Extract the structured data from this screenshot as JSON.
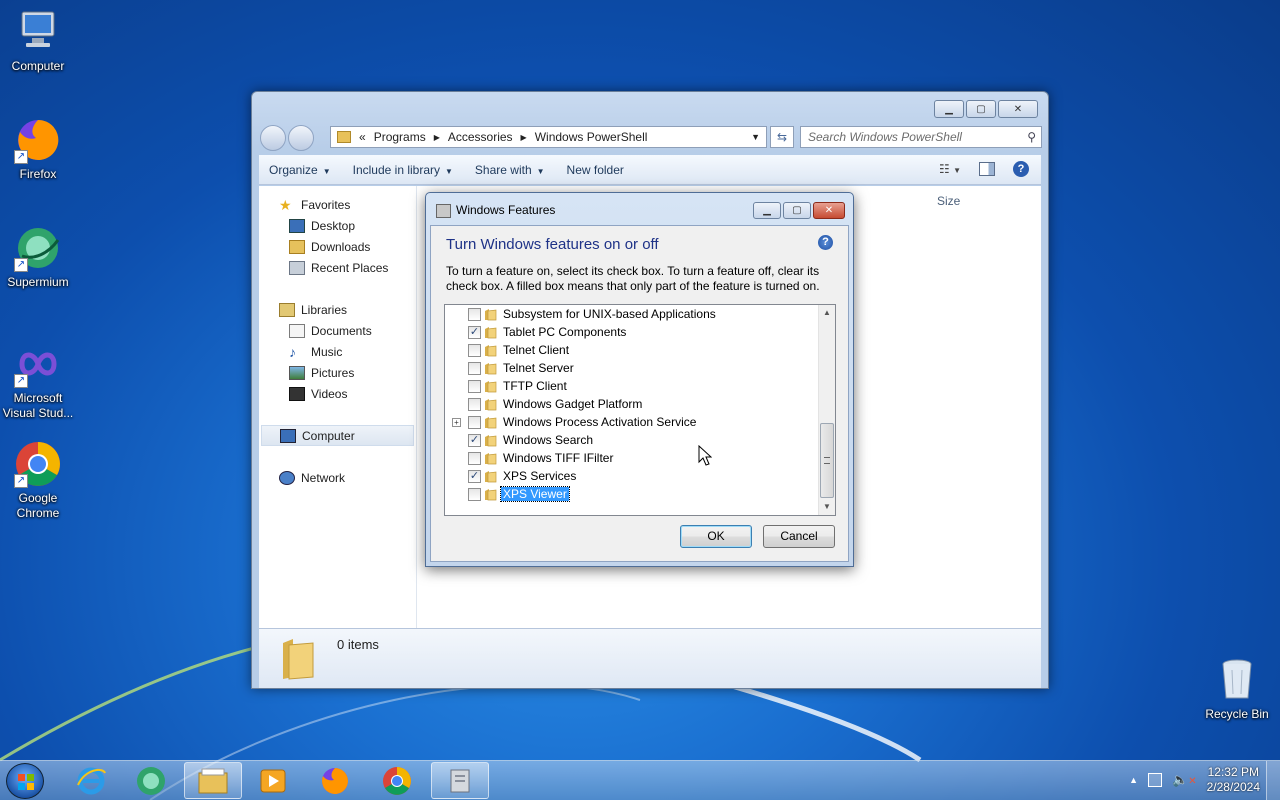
{
  "desktop": {
    "icons": [
      {
        "label": "Computer",
        "icon": "computer-icon"
      },
      {
        "label": "Firefox",
        "icon": "firefox-icon"
      },
      {
        "label": "Supermium",
        "icon": "supermium-icon"
      },
      {
        "label": "Microsoft Visual Stud...",
        "icon": "visual-studio-icon"
      },
      {
        "label": "Google Chrome",
        "icon": "chrome-icon"
      },
      {
        "label": "Recycle Bin",
        "icon": "recycle-bin-icon"
      }
    ]
  },
  "explorer": {
    "breadcrumb": {
      "prefix": "«",
      "parts": [
        "Programs",
        "Accessories",
        "Windows PowerShell"
      ]
    },
    "search_placeholder": "Search Windows PowerShell",
    "commands": {
      "organize": "Organize",
      "include": "Include in library",
      "share": "Share with",
      "new_folder": "New folder"
    },
    "nav": {
      "favorites": "Favorites",
      "desktop": "Desktop",
      "downloads": "Downloads",
      "recent": "Recent Places",
      "libraries": "Libraries",
      "documents": "Documents",
      "music": "Music",
      "pictures": "Pictures",
      "videos": "Videos",
      "computer": "Computer",
      "network": "Network"
    },
    "column_size": "Size",
    "status_items": "0 items"
  },
  "dialog": {
    "title": "Windows Features",
    "heading": "Turn Windows features on or off",
    "description": "To turn a feature on, select its check box. To turn a feature off, clear its check box. A filled box means that only part of the feature is turned on.",
    "features": [
      {
        "label": "Subsystem for UNIX-based Applications",
        "checked": false,
        "expandable": false
      },
      {
        "label": "Tablet PC Components",
        "checked": true,
        "expandable": false
      },
      {
        "label": "Telnet Client",
        "checked": false,
        "expandable": false
      },
      {
        "label": "Telnet Server",
        "checked": false,
        "expandable": false
      },
      {
        "label": "TFTP Client",
        "checked": false,
        "expandable": false
      },
      {
        "label": "Windows Gadget Platform",
        "checked": false,
        "expandable": false
      },
      {
        "label": "Windows Process Activation Service",
        "checked": false,
        "expandable": true
      },
      {
        "label": "Windows Search",
        "checked": true,
        "expandable": false
      },
      {
        "label": "Windows TIFF IFilter",
        "checked": false,
        "expandable": false
      },
      {
        "label": "XPS Services",
        "checked": true,
        "expandable": false
      },
      {
        "label": "XPS Viewer",
        "checked": false,
        "expandable": false,
        "selected": true
      }
    ],
    "ok": "OK",
    "cancel": "Cancel"
  },
  "taskbar": {
    "time": "12:32 PM",
    "date": "2/28/2024",
    "apps": [
      "internet-explorer-icon",
      "supermium-icon",
      "file-explorer-icon",
      "media-player-icon",
      "firefox-icon",
      "chrome-icon",
      "windows-features-icon"
    ]
  }
}
